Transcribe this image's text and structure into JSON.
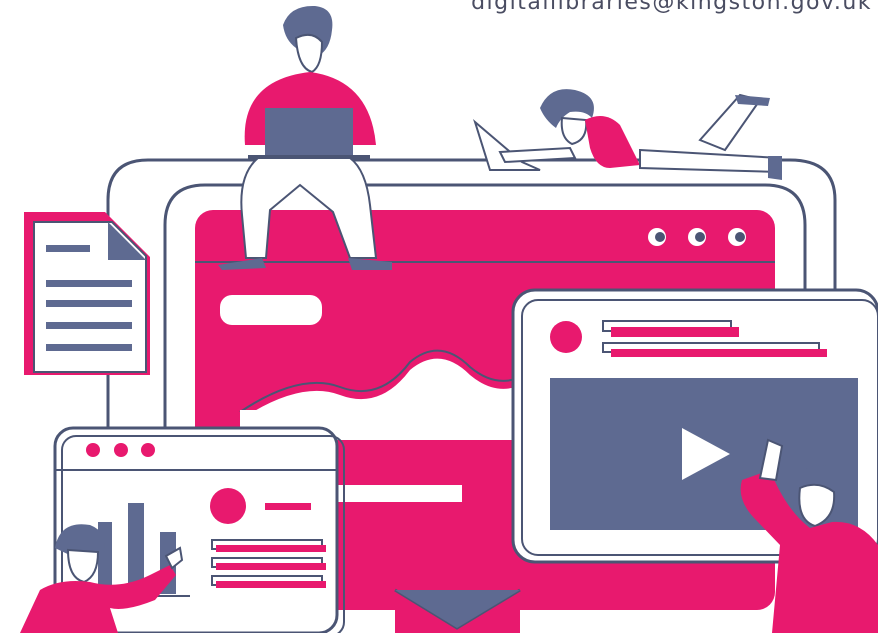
{
  "header": {
    "email": "digitallibraries@kingston.gov.uk"
  },
  "illustration": {
    "accent_color": "#e8196e",
    "secondary_color": "#5e6a91",
    "outline_color": "#4b5574",
    "background_color": "#ffffff",
    "icons": [
      "browser-window-icon",
      "document-icon",
      "video-player-icon",
      "analytics-card-icon",
      "email-envelope-icon"
    ]
  }
}
